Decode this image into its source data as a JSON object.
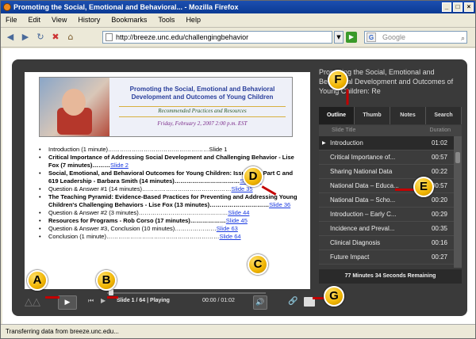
{
  "window": {
    "title": "Promoting the Social, Emotional and Behavioral... - Mozilla Firefox"
  },
  "menu": [
    "File",
    "Edit",
    "View",
    "History",
    "Bookmarks",
    "Tools",
    "Help"
  ],
  "nav": {
    "url": "http://breeze.unc.edu/challengingbehavior",
    "search_placeholder": "Google"
  },
  "slide": {
    "banner": {
      "title": "Promoting the Social, Emotional and Behavioral Development and Outcomes of Young Children",
      "subtitle": "Recommended Practices and Resources",
      "date": "Friday, February 2, 2007     2:00 p.m. EST"
    },
    "outline": [
      {
        "label": "Introduction (1 minute)……………………………………………Slide 1"
      },
      {
        "label": "Critical Importance of Addressing Social Development and Challenging Behavior - Lise Fox (7 minutes)………",
        "link": "Slide 2"
      },
      {
        "label": "Social, Emotional, and Behavioral Outcomes for Young Children: Issues for Part C and 619 Leadership - Barbara Smith (14 minutes)……………………………",
        "link": "Slide 21"
      },
      {
        "label": "Question & Answer #1 (14 minutes)………………………………………",
        "link": "Slide 35"
      },
      {
        "label": "The Teaching Pyramid: Evidence-Based Practices for Preventing and Addressing Young Children's Challenging Behaviors - Lise Fox (13 minutes)…………………………",
        "link": "Slide 36"
      },
      {
        "label": "Question & Answer #2 (3 minutes)………………………………………",
        "link": "Slide 44"
      },
      {
        "label": "Resources for Programs - Rob Corso (17 minutes)………………",
        "link": "Slide 45"
      },
      {
        "label": "Question & Answer #3, Conclusion (10 minutes)…………………",
        "link": "Slide 63"
      },
      {
        "label": "Conclusion (1 minute)…………………………………………………",
        "link": "Slide 64"
      }
    ]
  },
  "panel": {
    "title": "Promoting the Social, Emotional and Behavioral Development and Outcomes of Young Children: Re",
    "tabs": [
      "Outline",
      "Thumb",
      "Notes",
      "Search"
    ],
    "col_title": "Slide Title",
    "col_duration": "Duration",
    "items": [
      {
        "title": "Introduction",
        "duration": "01:02"
      },
      {
        "title": "Critical Importance of...",
        "duration": "00:57"
      },
      {
        "title": "Sharing National Data",
        "duration": "00:22"
      },
      {
        "title": "National Data – Educa...",
        "duration": "00:57"
      },
      {
        "title": "National Data – Scho...",
        "duration": "00:20"
      },
      {
        "title": "Introduction – Early C...",
        "duration": "00:29"
      },
      {
        "title": "Incidence and Preval...",
        "duration": "00:35"
      },
      {
        "title": "Clinical Diagnosis",
        "duration": "00:16"
      },
      {
        "title": "Future Impact",
        "duration": "00:27"
      }
    ],
    "remaining": "77 Minutes 34 Seconds Remaining"
  },
  "controls": {
    "slide_info": "Slide 1 / 64 | Playing",
    "time": "00:00 / 01:02"
  },
  "markers": [
    "A",
    "B",
    "C",
    "D",
    "E",
    "F",
    "G"
  ],
  "status": "Transferring data from breeze.unc.edu...",
  "colors": {
    "marker": "#f0b400",
    "link": "#1a3ae0",
    "banner_title": "#2a3f9c"
  }
}
